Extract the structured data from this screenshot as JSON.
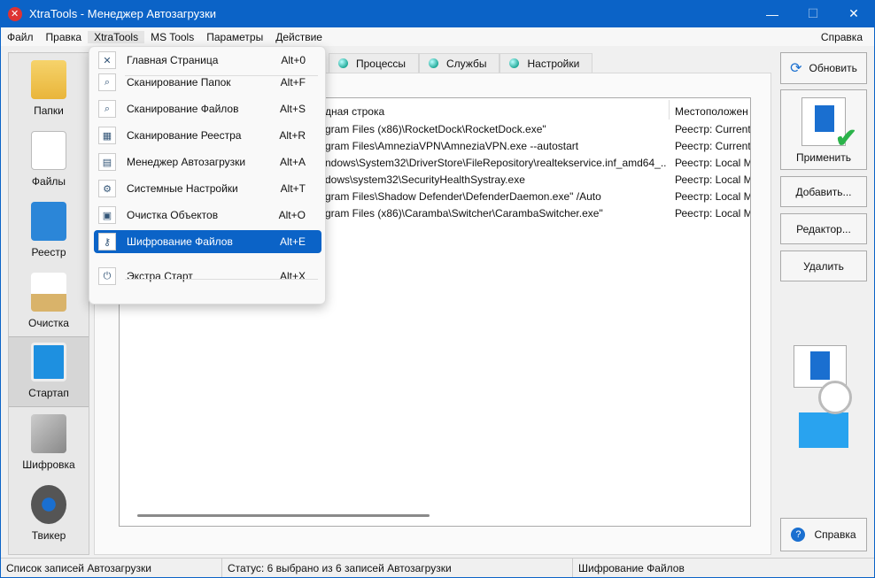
{
  "window": {
    "title": "XtraTools - Менеджер Автозагрузки"
  },
  "menubar": [
    "Файл",
    "Правка",
    "XtraTools",
    "MS Tools",
    "Параметры",
    "Действие"
  ],
  "menubar_help": "Справка",
  "sidebar": [
    {
      "label": "Папки",
      "icon": "folder-search-icon"
    },
    {
      "label": "Файлы",
      "icon": "file-search-icon"
    },
    {
      "label": "Реестр",
      "icon": "registry-icon"
    },
    {
      "label": "Очистка",
      "icon": "cleanup-icon"
    },
    {
      "label": "Стартап",
      "icon": "startup-icon"
    },
    {
      "label": "Шифровка",
      "icon": "keys-icon"
    },
    {
      "label": "Твикер",
      "icon": "gear-icon"
    }
  ],
  "tabs": [
    "Процессы",
    "Службы",
    "Настройки"
  ],
  "table": {
    "columns": [
      "дная строка",
      "Местоположен"
    ],
    "rows": [
      [
        "gram Files (x86)\\RocketDock\\RocketDock.exe\"",
        "Реестр: Current"
      ],
      [
        "gram Files\\AmneziaVPN\\AmneziaVPN.exe --autostart",
        "Реестр: Current"
      ],
      [
        "ndows\\System32\\DriverStore\\FileRepository\\realtekservice.inf_amd64_...",
        "Реестр: Local M"
      ],
      [
        "dows\\system32\\SecurityHealthSystray.exe",
        "Реестр: Local M"
      ],
      [
        "gram Files\\Shadow Defender\\DefenderDaemon.exe\" /Auto",
        "Реестр: Local M"
      ],
      [
        "gram Files (x86)\\Caramba\\Switcher\\CarambaSwitcher.exe\"",
        "Реестр: Local M"
      ]
    ]
  },
  "buttons": {
    "refresh": "Обновить",
    "apply": "Применить",
    "add": "Добавить...",
    "editor": "Редактор...",
    "delete": "Удалить",
    "help": "Справка"
  },
  "dropdown": [
    {
      "label": "Главная Страница",
      "shortcut": "Alt+0"
    },
    {
      "label": "Сканирование Папок",
      "shortcut": "Alt+F"
    },
    {
      "label": "Сканирование Файлов",
      "shortcut": "Alt+S"
    },
    {
      "label": "Сканирование Реестра",
      "shortcut": "Alt+R"
    },
    {
      "label": "Менеджер Автозагрузки",
      "shortcut": "Alt+A"
    },
    {
      "label": "Системные Настройки",
      "shortcut": "Alt+T"
    },
    {
      "label": "Очистка Объектов",
      "shortcut": "Alt+O"
    },
    {
      "label": "Шифрование Файлов",
      "shortcut": "Alt+E"
    },
    {
      "label": "Экстра Старт",
      "shortcut": "Alt+X"
    }
  ],
  "status": [
    "Список записей Автозагрузки",
    "Статус: 6 выбрано из 6 записей Автозагрузки",
    "Шифрование Файлов"
  ]
}
